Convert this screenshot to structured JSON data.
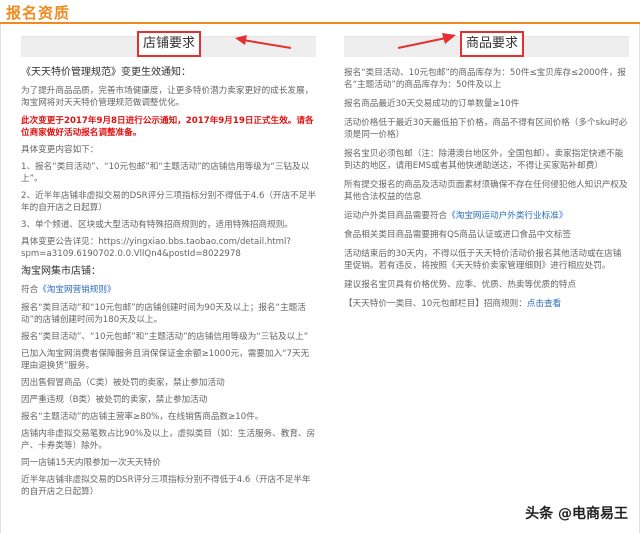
{
  "header": {
    "title": "报名资质"
  },
  "left": {
    "heading": "店铺要求",
    "rule_title": "《天天特价管理规范》变更生效通知：",
    "intro": "为了提升商品品质，完善市场健康度，让更多特价潜力卖家更好的成长发展，淘宝网将对天天特价管理规范做调整优化。",
    "notice": "此次变更于2017年9月8日进行公示通知，2017年9月19日正式生效。请各位商家做好活动报名调整准备。",
    "change_label": "具体变更内容如下：",
    "changes": [
      "1、报名“类目活动”、“10元包邮”和“主题活动”的店铺信用等级为“三钻及以上”。",
      "2、近半年店铺非虚拟交易的DSR评分三项指标分别不得低于4.6（开店不足半年的自开店之日起算）",
      "3、单个频道、区块或大型活动有特殊招商规则的，适用特殊招商规则。"
    ],
    "detail_label": "具体变更公告详见：",
    "detail_url": "https://yingxiao.bbs.taobao.com/detail.html?spm=a3109.6190702.0.0.VllQn4&postId=8022978",
    "market_title": "淘宝网集市店铺：",
    "conform_prefix": "符合",
    "conform_link": "《淘宝网营销规则》",
    "rules": [
      "报名“类目活动”和“10元包邮”的店铺创建时间为90天及以上；报名“主题活动”的店铺创建时间为180天及以上。",
      "报名“类目活动”、“10元包邮”和“主题活动”的店铺信用等级为“三钻及以上”",
      "已加入淘宝网消费者保障服务且消保保证金余额≥1000元，需要加入“7天无理由退换货”服务。",
      "因出售假冒商品（C类）被处罚的卖家，禁止参加活动",
      "因严重违规（B类）被处罚的卖家，禁止参加活动",
      "报名“主题活动”的店铺主营率≥80%，在线销售商品数≥10件。",
      "店铺内非虚拟交易笔数占比90%及以上，虚拟类目（如：生活服务、教育、房产、卡券类等）除外。",
      "同一店铺15天内限参加一次天天特价",
      "近半年店铺非虚拟交易的DSR评分三项指标分别不得低于4.6（开店不足半年的自开店之日起算）"
    ]
  },
  "right": {
    "heading": "商品要求",
    "items": [
      "报名“类目活动、10元包邮”的商品库存为：50件≤宝贝库存≤2000件，报名“主题活动”的商品库存为：50件及以上",
      "报名商品最近30天交易成功的订单数量≥10件",
      "活动价格低于最近30天最低拍下价格，商品不得有区间价格（多个sku时必须是同一价格）",
      "报名宝贝必须包邮（注：除港澳台地区外，全国包邮）。卖家指定快递不能到达的地区，请用EMS或者其他快递助送达，不得让买家贴补邮费）",
      "所有提交报名的商品及活动页面素材须确保不存在任何侵犯他人知识产权及其他合法权益的信息"
    ],
    "outdoor_prefix": "运动户外类目商品需要符合",
    "outdoor_link": "《淘宝网运动户外类行业标准》",
    "items2": [
      "食品相关类目商品需要拥有QS商品认证或进口食品中文标签",
      "活动结束后的30天内，不得以低于天天特价活动价报名其他活动或在店铺里促销。若有违反，将按照《天天特价卖家管理细则》进行相应处罚。",
      "建议报名宝贝具有价格优势、应季、优质、热卖等优质的特点"
    ],
    "footer_prefix": "【天天特价一类目、10元包邮栏目】招商规则：",
    "footer_link": "点击查看"
  },
  "watermark": "头条 @电商易王"
}
